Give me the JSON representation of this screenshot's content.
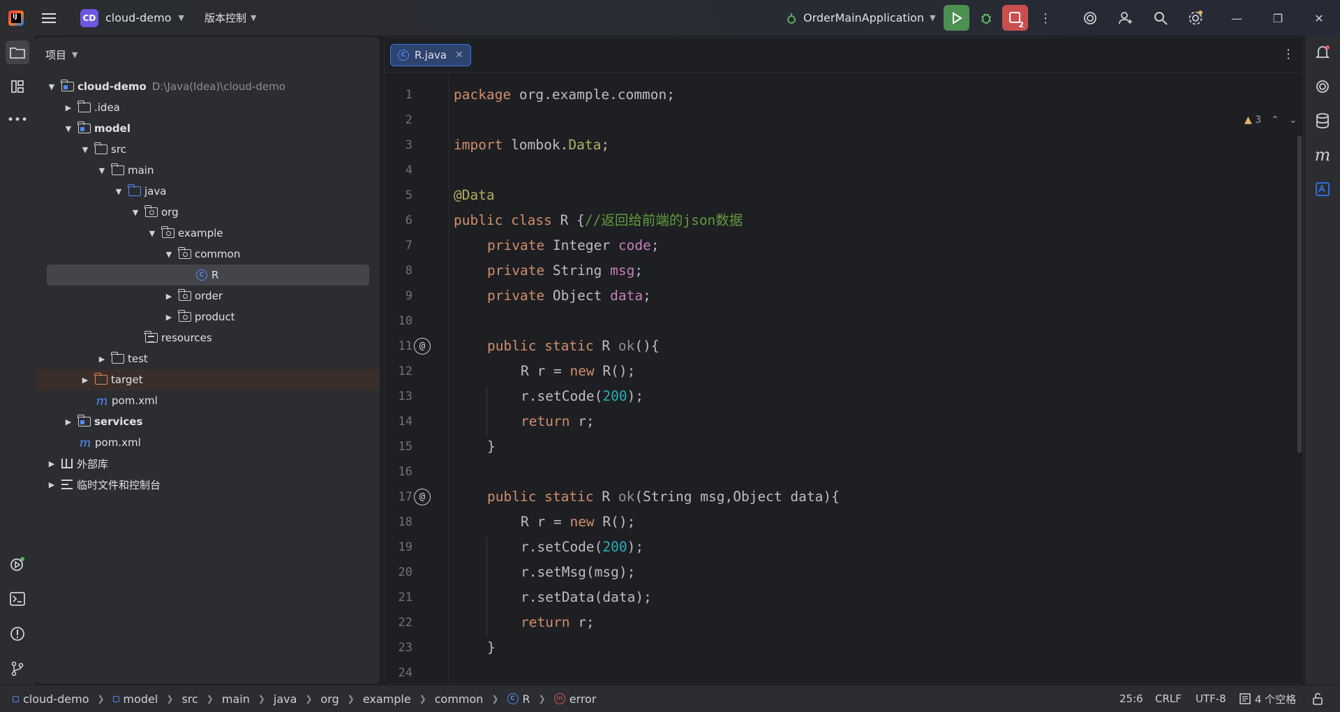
{
  "titlebar": {
    "project_badge": "CD",
    "project_name": "cloud-demo",
    "vcs_label": "版本控制",
    "run_config": "OrderMainApplication",
    "restart_badge": "2"
  },
  "project_panel": {
    "title": "项目",
    "tree": [
      {
        "label": "cloud-demo",
        "path": "D:\\Java(Idea)\\cloud-demo",
        "bold": true
      },
      {
        "label": ".idea"
      },
      {
        "label": "model",
        "bold": true
      },
      {
        "label": "src"
      },
      {
        "label": "main"
      },
      {
        "label": "java"
      },
      {
        "label": "org"
      },
      {
        "label": "example"
      },
      {
        "label": "common"
      },
      {
        "label": "R"
      },
      {
        "label": "order"
      },
      {
        "label": "product"
      },
      {
        "label": "resources"
      },
      {
        "label": "test"
      },
      {
        "label": "target"
      },
      {
        "label": "pom.xml"
      },
      {
        "label": "services",
        "bold": true
      },
      {
        "label": "pom.xml"
      },
      {
        "label": "外部库"
      },
      {
        "label": "临时文件和控制台"
      }
    ]
  },
  "editor": {
    "tab_label": "R.java",
    "warnings_count": "3",
    "line_numbers": [
      "1",
      "2",
      "3",
      "4",
      "5",
      "6",
      "7",
      "8",
      "9",
      "10",
      "11",
      "12",
      "13",
      "14",
      "15",
      "16",
      "17",
      "18",
      "19",
      "20",
      "21",
      "22",
      "23",
      "24"
    ],
    "code": {
      "l1_kw": "package",
      "l1_rest": " org.example.common;",
      "l3_kw": "import",
      "l3_rest": " lombok.",
      "l3_ann": "Data",
      "l3_end": ";",
      "l5_ann": "@Data",
      "l6_kw": "public class",
      "l6_rest": " R {",
      "l6_cmt": "//返回给前端的json数据",
      "l7_kw": "private",
      "l7_type": " Integer ",
      "l7_fld": "code",
      "l7_end": ";",
      "l8_kw": "private",
      "l8_type": " String ",
      "l8_fld": "msg",
      "l8_end": ";",
      "l9_kw": "private",
      "l9_type": " Object ",
      "l9_fld": "data",
      "l9_end": ";",
      "l11_kw": "public static",
      "l11_type": " R ",
      "l11_mth": "ok",
      "l11_end": "(){",
      "l12_a": "R r = ",
      "l12_kw": "new",
      "l12_b": " R();",
      "l13_a": "r.setCode(",
      "l13_num": "200",
      "l13_b": ");",
      "l14_kw": "return",
      "l14_b": " r;",
      "l15": "}",
      "l17_kw": "public static",
      "l17_type": " R ",
      "l17_mth": "ok",
      "l17_end": "(String msg,Object data){",
      "l18_a": "R r = ",
      "l18_kw": "new",
      "l18_b": " R();",
      "l19_a": "r.setCode(",
      "l19_num": "200",
      "l19_b": ");",
      "l20": "r.setMsg(msg);",
      "l21": "r.setData(data);",
      "l22_kw": "return",
      "l22_b": " r;",
      "l23": "}"
    }
  },
  "statusbar": {
    "breadcrumbs": [
      "cloud-demo",
      "model",
      "src",
      "main",
      "java",
      "org",
      "example",
      "common",
      "R",
      "error"
    ],
    "cursor": "25:6",
    "line_sep": "CRLF",
    "encoding": "UTF-8",
    "indent": "4 个空格"
  },
  "colors": {
    "accent": "#3574f0",
    "run_green": "#5fb865",
    "stop_red": "#e55765",
    "keyword": "#cf8e6d",
    "annotation": "#b3ae60",
    "field": "#c77dbb",
    "number": "#2aacb8",
    "comment": "#5f9c3f"
  },
  "icons": [
    "hamburger-menu-icon",
    "run-icon",
    "debug-icon",
    "stop-icon",
    "more-icon",
    "ai-assistant-icon",
    "add-user-icon",
    "search-icon",
    "settings-icon",
    "notifications-icon",
    "database-icon",
    "maven-icon",
    "folder-icon",
    "structure-icon",
    "services-icon",
    "terminal-icon",
    "problems-icon",
    "git-icon"
  ]
}
